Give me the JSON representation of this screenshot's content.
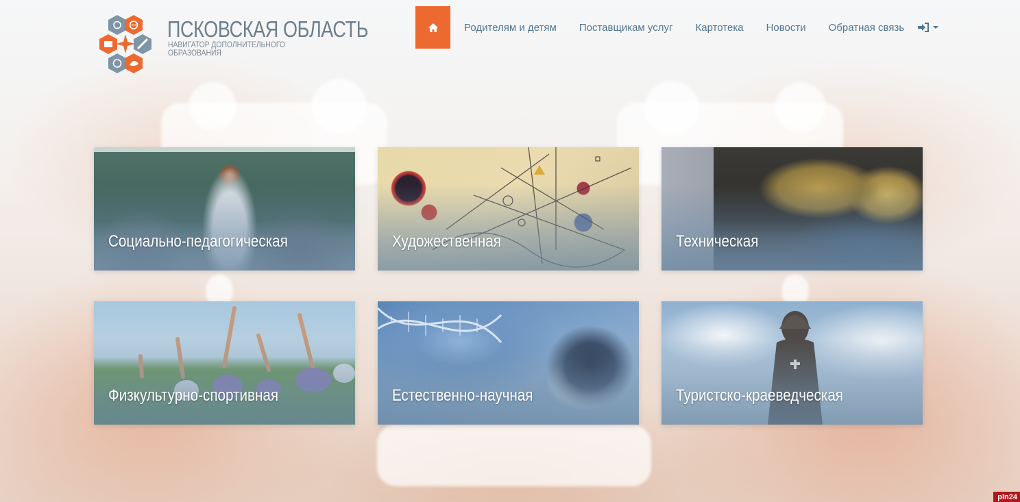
{
  "brand": {
    "title": "ПСКОВСКАЯ ОБЛАСТЬ",
    "subtitle": "НАВИГАТОР ДОПОЛНИТЕЛЬНОГО ОБРАЗОВАНИЯ",
    "accent_color": "#ec6a2f",
    "secondary_color": "#4f7795"
  },
  "nav": {
    "home_icon": "home-icon",
    "items": [
      {
        "label": "Родителям и детям"
      },
      {
        "label": "Поставщикам услуг"
      },
      {
        "label": "Картотека"
      },
      {
        "label": "Новости"
      },
      {
        "label": "Обратная связь"
      }
    ],
    "login_icon": "sign-in-icon",
    "login_caret": "caret-down-icon"
  },
  "categories": [
    {
      "label": "Социально-педагогическая"
    },
    {
      "label": "Художественная"
    },
    {
      "label": "Техническая"
    },
    {
      "label": "Физкультурно-спортивная"
    },
    {
      "label": "Естественно-научная"
    },
    {
      "label": "Туристско-краеведческая"
    }
  ],
  "watermark": "pln24"
}
